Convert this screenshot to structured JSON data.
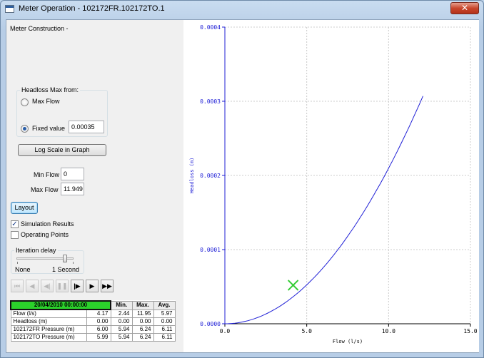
{
  "window": {
    "title": "Meter Operation - 102172FR.102172TO.1",
    "close_symbol": "✕"
  },
  "left_panel": {
    "construction_label": "Meter Construction -",
    "headloss_group": {
      "legend": "Headloss Max from:",
      "max_flow_label": "Max Flow",
      "fixed_value_label": "Fixed value",
      "fixed_value": "0.00035",
      "selected": "fixed_value"
    },
    "log_scale_button": "Log Scale in Graph",
    "min_flow_label": "Min Flow",
    "min_flow_value": "0",
    "max_flow_label": "Max Flow",
    "max_flow_value": "11.949",
    "layout_button": "Layout",
    "simulation_results_label": "Simulation Results",
    "simulation_results_checked": true,
    "operating_points_label": "Operating Points",
    "operating_points_checked": false,
    "iteration_delay": {
      "legend": "Iteration delay",
      "min_label": "None",
      "max_label": "1 Second",
      "level": 0.85
    },
    "media_controls": [
      {
        "name": "first-button",
        "glyph": "⏮",
        "enabled": false
      },
      {
        "name": "step-back-button",
        "glyph": "◀",
        "enabled": false
      },
      {
        "name": "back-button",
        "glyph": "◀|",
        "enabled": false
      },
      {
        "name": "pause-button",
        "glyph": "❚❚",
        "enabled": false
      },
      {
        "name": "step-forward-button",
        "glyph": "|▶",
        "enabled": true
      },
      {
        "name": "play-button",
        "glyph": "▶",
        "enabled": true
      },
      {
        "name": "fast-forward-button",
        "glyph": "▶▶",
        "enabled": true
      }
    ],
    "results_table": {
      "date": "20/04/2010 00:00:00",
      "headers": [
        "Min.",
        "Max.",
        "Avg."
      ],
      "rows": [
        {
          "label": "Flow (l/s)",
          "value": "4.17",
          "min": "2.44",
          "max": "11.95",
          "avg": "5.97"
        },
        {
          "label": "Headloss (m)",
          "value": "0.00",
          "min": "0.00",
          "max": "0.00",
          "avg": "0.00"
        },
        {
          "label": "102172FR Pressure (m)",
          "value": "6.00",
          "min": "5.94",
          "max": "6.24",
          "avg": "6.11"
        },
        {
          "label": "102172TO Pressure (m)",
          "value": "5.99",
          "min": "5.94",
          "max": "6.24",
          "avg": "6.11"
        }
      ]
    }
  },
  "chart_data": {
    "type": "line",
    "xlabel": "Flow (l/s)",
    "ylabel": "Headloss (m)",
    "xlim": [
      0,
      15
    ],
    "ylim": [
      0,
      0.0004
    ],
    "x_ticks": [
      "0.0",
      "5.0",
      "10.0",
      "15.0"
    ],
    "y_ticks": [
      "0.0000",
      "0.0001",
      "0.0002",
      "0.0003",
      "0.0004"
    ],
    "grid": true,
    "series": [
      {
        "color": "#1f1fd6",
        "x": [
          0,
          1,
          2,
          3,
          4,
          5,
          6,
          7,
          8,
          9,
          10,
          11,
          12.1
        ],
        "y": [
          0,
          1.7e-06,
          8.7e-06,
          2.1e-05,
          3.9e-05,
          6.2e-05,
          9e-05,
          0.000123,
          0.000161,
          0.000204,
          0.000252,
          0.000304,
          0.000307
        ]
      }
    ],
    "operating_point": {
      "x": 4.17,
      "y": 5.2e-05,
      "marker": "x",
      "color": "#33cc33"
    }
  }
}
